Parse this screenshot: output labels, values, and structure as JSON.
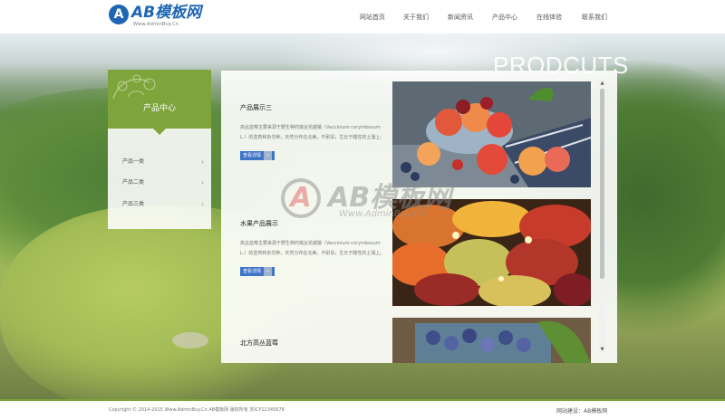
{
  "brand": {
    "mark": "A",
    "name": "AB模板网",
    "tagline": "Www.AdminBuy.Cn"
  },
  "nav": {
    "items": [
      {
        "label": "网站首页"
      },
      {
        "label": "关于我们"
      },
      {
        "label": "新闻资讯"
      },
      {
        "label": "产品中心"
      },
      {
        "label": "在线体验"
      },
      {
        "label": "联系我们"
      }
    ]
  },
  "hero": {
    "section_title": "PRODCUTS"
  },
  "sidebar": {
    "title": "产品中心",
    "items": [
      {
        "label": "产品一类",
        "chevron": "›"
      },
      {
        "label": "产品二类",
        "chevron": "›"
      },
      {
        "label": "产品三类",
        "chevron": "›"
      }
    ]
  },
  "products": [
    {
      "title": "产品展示三",
      "desc": "高丛蓝莓主要来源于野生种的矮丛花越橘（Vaccinium corymbosum L.）的选育和杂交种，天然分布在北美，不耐旱，生长于酸性的土壤上。",
      "button": "查看详情",
      "button_arrow": "»"
    },
    {
      "title": "水果产品展示",
      "desc": "高丛蓝莓主要来源于野生种的矮丛花越橘（Vaccinium corymbosum L.）的选育和杂交种，天然分布在北美，不耐旱，生长于酸性的土壤上。",
      "button": "查看详情",
      "button_arrow": "»"
    },
    {
      "title": "北方高丛蓝莓"
    }
  ],
  "scrollbar": {
    "up": "▲",
    "down": "▼"
  },
  "watermark": {
    "mark": "A",
    "name": "AB模板网",
    "url": "Www.AdminBuy.Cn"
  },
  "footer": {
    "copyright": "Copyright © 2014-2015 Www.AdminBuy.Cn AB模板网  版权所有  苏ICP12345678",
    "right": "网站建设：AB模板网"
  },
  "colors": {
    "brand_blue": "#1e66b3",
    "accent_green": "#7ea43c",
    "button_blue": "#3f74c7"
  }
}
